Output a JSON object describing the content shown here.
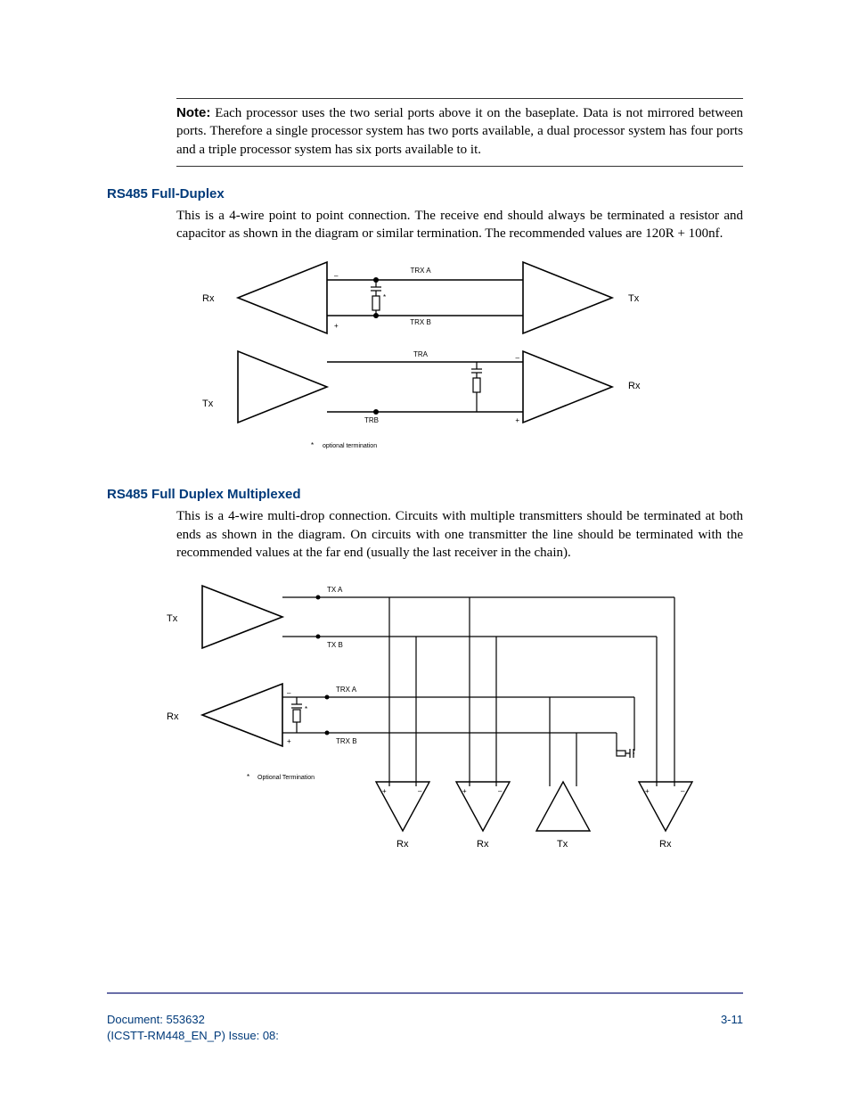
{
  "note": {
    "label": "Note:",
    "text": "Each processor uses the two serial ports above it on the baseplate. Data is not mirrored between ports. Therefore a single processor system has two ports available, a dual processor system has four ports and a triple processor system has six ports available to it."
  },
  "section1": {
    "heading": "RS485 Full-Duplex",
    "para": "This is a 4-wire point to point connection. The receive end should always be terminated a resistor and  capacitor as shown in the diagram or similar termination. The recommended values are 120R + 100nf."
  },
  "fig1": {
    "rx_left": "Rx",
    "tx_right": "Tx",
    "tx_left": "Tx",
    "rx_right": "Rx",
    "trx_a": "TRX A",
    "trx_b": "TRX B",
    "tr_a": "TRA",
    "tr_b": "TRB",
    "minus": "–",
    "plus": "+",
    "star": "*",
    "opt_term": "optional termination"
  },
  "section2": {
    "heading": "RS485 Full Duplex Multiplexed",
    "para": "This is a 4-wire multi-drop connection. Circuits with multiple transmitters should be terminated at both ends as shown in the diagram. On circuits with one transmitter the line should be terminated with the recommended values at the far end (usually the last receiver in the chain)."
  },
  "fig2": {
    "tx": "Tx",
    "rx": "Rx",
    "tx_a": "TX A",
    "tx_b": "TX B",
    "trx_a": "TRX A",
    "trx_b": "TRX B",
    "opt_term": "Optional Termination",
    "minus": "–",
    "plus": "+",
    "star": "*"
  },
  "footer": {
    "doc": "Document: 553632",
    "issue": "(ICSTT-RM448_EN_P) Issue: 08:",
    "page": "3-11"
  }
}
